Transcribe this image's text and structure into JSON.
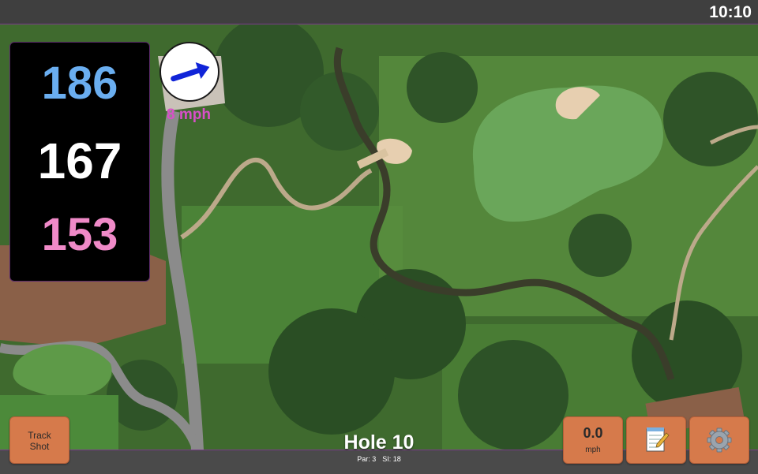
{
  "status_bar": {
    "time": "10:10"
  },
  "distances": {
    "back": "186",
    "middle": "167",
    "front": "153"
  },
  "wind": {
    "speed": "8 mph",
    "direction_icon": "wind-arrow-icon"
  },
  "hole": {
    "title": "Hole 10",
    "par": "Par: 3",
    "stroke_index": "SI: 18"
  },
  "buttons": {
    "track_shot_line1": "Track",
    "track_shot_line2": "Shot",
    "speed_value": "0.0",
    "speed_unit": "mph",
    "notes_icon": "notepad-icon",
    "settings_icon": "gear-icon"
  },
  "colors": {
    "back_distance": "#6aaef0",
    "middle_distance": "#ffffff",
    "front_distance": "#f08ac8",
    "wind_text": "#d84fc8",
    "button_bg": "#d67a4b"
  }
}
